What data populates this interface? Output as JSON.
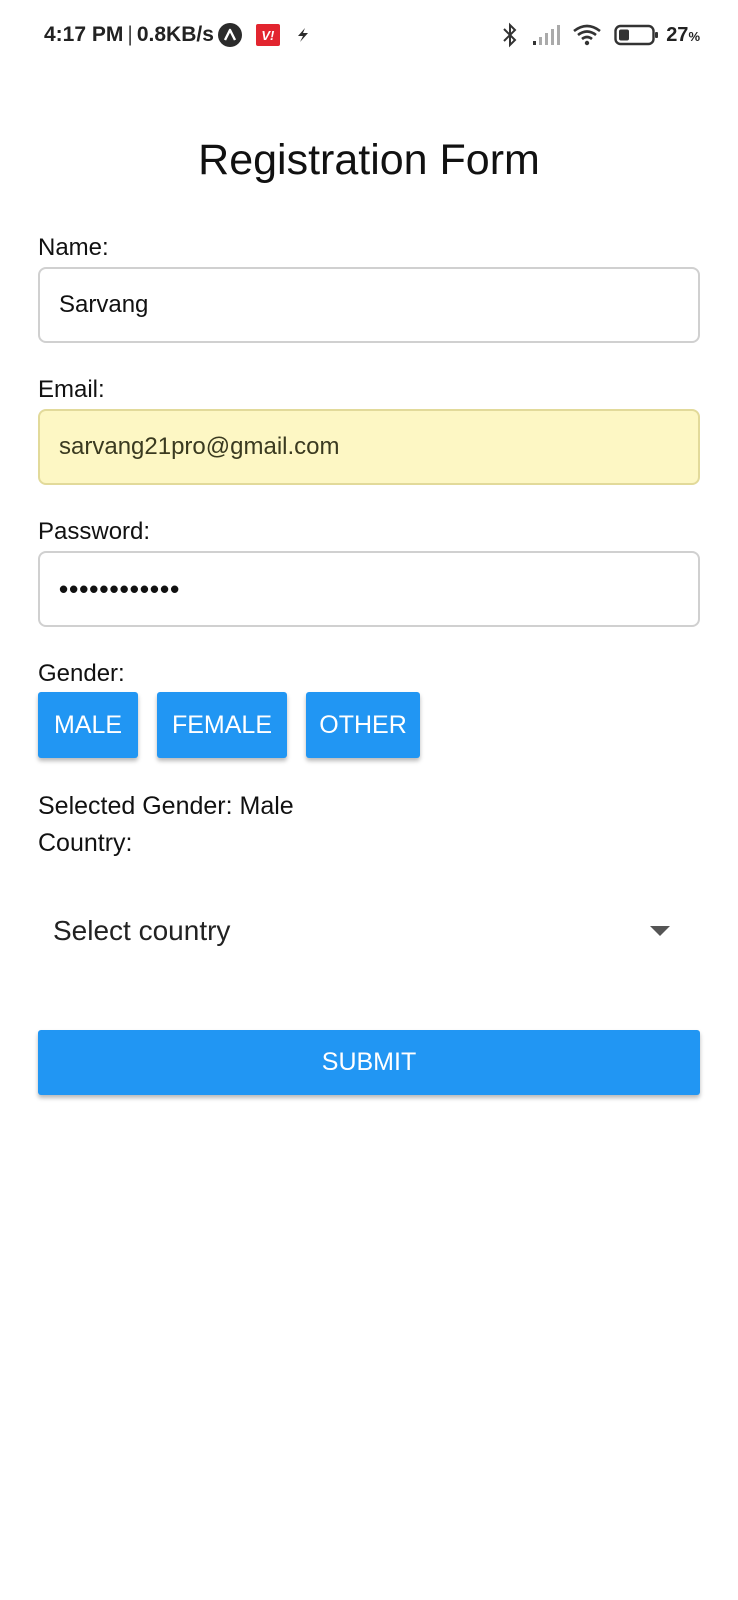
{
  "status_bar": {
    "time": "4:17 PM",
    "separator": "|",
    "net_speed": "0.8KB/s",
    "vi_badge": "V!",
    "battery_value": "27",
    "battery_unit": "%",
    "icons": [
      "app-a-icon",
      "vi-app-icon",
      "flash-icon",
      "bluetooth-icon",
      "cellular-signal-icon",
      "wifi-icon",
      "battery-icon"
    ]
  },
  "form": {
    "title": "Registration Form",
    "name": {
      "label": "Name:",
      "value": "Sarvang"
    },
    "email": {
      "label": "Email:",
      "value": "sarvang21pro@gmail.com"
    },
    "password": {
      "label": "Password:",
      "masked_value": "••••••••••••"
    },
    "gender": {
      "label": "Gender:",
      "options": [
        "MALE",
        "FEMALE",
        "OTHER"
      ],
      "selected_text": "Selected Gender: Male"
    },
    "country": {
      "label": "Country:",
      "selected": "Select country"
    },
    "submit_label": "SUBMIT"
  },
  "colors": {
    "primary_button": "#2196f3",
    "autofill_background": "#fdf7c4",
    "field_border": "#d0d0d0"
  }
}
